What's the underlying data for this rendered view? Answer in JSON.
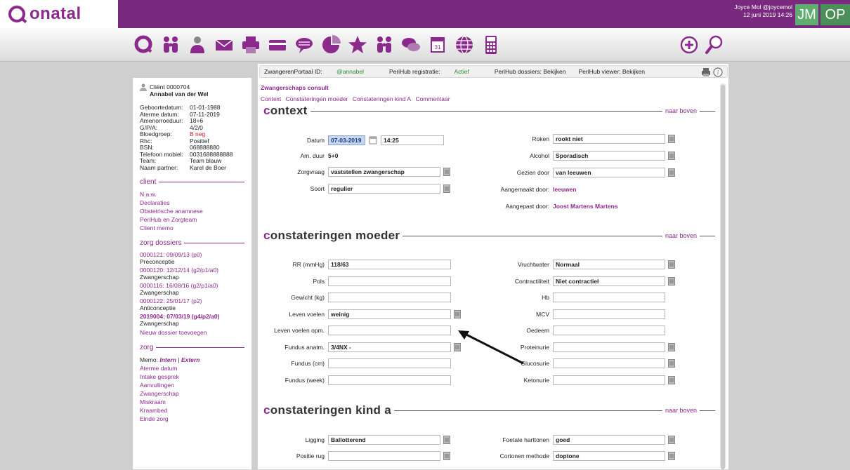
{
  "app": {
    "logo": "onatal",
    "user_name": "Joyce Mol @joycemol",
    "user_date": "12 juni 2019 14:26",
    "badge_jm": "JM",
    "badge_op": "OP"
  },
  "sidebar": {
    "client_id": "Cliënt 0000704",
    "client_name": "Annabel van der Wel",
    "details": [
      {
        "k": "Geboortedatum:",
        "v": "01-01-1988"
      },
      {
        "k": "Aterme datum:",
        "v": "07-11-2019"
      },
      {
        "k": "Amenorroeduur:",
        "v": "18+6"
      },
      {
        "k": "G/P/A:",
        "v": "4/2/0"
      },
      {
        "k": "Bloedgroep:",
        "v": "B neg"
      },
      {
        "k": "Rhc:",
        "v": "Positief"
      },
      {
        "k": "BSN:",
        "v": "068888880"
      },
      {
        "k": "Telefoon mobiel:",
        "v": "0031688888888"
      },
      {
        "k": "Team:",
        "v": "Team blauw"
      },
      {
        "k": "Naam partner:",
        "v": "Karel de Boer"
      }
    ],
    "client_section": "client",
    "client_links": [
      "N.a.w.",
      "Declaraties",
      "Obstetrische anamnese",
      "PeriHub en Zorgteam",
      "Client memo"
    ],
    "dossiers_section": "zorg dossiers",
    "dossiers": [
      {
        "link": "0000121: 09/09/13 (p0)",
        "sub": "Preconceptie"
      },
      {
        "link": "0000120: 12/12/14 (g2/p1/a0)",
        "sub": "Zwangerschap"
      },
      {
        "link": "0000116: 16/08/16 (g2/p1/a0)",
        "sub": "Zwangerschap"
      },
      {
        "link": "0000122: 25/01/17 (p2)",
        "sub": "Anticonceptie"
      },
      {
        "link": "2019004: 07/03/19 (g4/p2/a0)",
        "sub": "Zwangerschap"
      }
    ],
    "new_dossier": "Nieuw dossier toevoegen",
    "zorg_section": "zorg",
    "memo_label": "Memo:",
    "memo_intern": "Intern",
    "memo_sep": "|",
    "memo_extern": "Extern",
    "zorg_links": [
      "Aterme datum",
      "Intake gesprek",
      "Aanvullingen",
      "Zwangerschap",
      "Miskraam",
      "Kraambed",
      "Einde zorg"
    ]
  },
  "portal": {
    "id_label": "ZwangerenPortaal ID:",
    "id_value": "@annabel",
    "reg_label": "PeriHub registratie:",
    "reg_value": "Actief",
    "dossiers": "PeriHub dossiers: Bekijken",
    "viewer": "PeriHub viewer: Bekijken"
  },
  "consult": {
    "title": "Zwangerschaps consult",
    "tabs": [
      "Context",
      "Constateringen moeder",
      "Constateringen kind A",
      "Commentaar"
    ],
    "naar_boven": "naar boven"
  },
  "context": {
    "heading_first": "c",
    "heading_rest": "ontext",
    "datum_label": "Datum",
    "datum_value": "07-03-2019",
    "tijd_value": "14:25",
    "amduur_label": "Am. duur",
    "amduur_value": "5+0",
    "zorgvraag_label": "Zorgvraag",
    "zorgvraag_value": "vaststellen zwangerschap",
    "soort_label": "Soort",
    "soort_value": "regulier",
    "roken_label": "Roken",
    "roken_value": "rookt niet",
    "alcohol_label": "Alcohol",
    "alcohol_value": "Sporadisch",
    "gezien_label": "Gezien door",
    "gezien_value": "van leeuwen",
    "aangemaakt_label": "Aangemaakt door:",
    "aangemaakt_value": "leeuwen",
    "aangepast_label": "Aangepast door:",
    "aangepast_value": "Joost Martens Martens"
  },
  "moeder": {
    "heading_first": "c",
    "heading_rest": "onstateringen moeder",
    "left": [
      {
        "label": "RR (mmHg)",
        "value": "118/63",
        "doc": false
      },
      {
        "label": "Pols",
        "value": "",
        "doc": false
      },
      {
        "label": "Gewicht (kg)",
        "value": "",
        "doc": false
      },
      {
        "label": "Leven voelen",
        "value": "weinig",
        "doc": true
      },
      {
        "label": "Leven voelen opm.",
        "value": "",
        "doc": false
      },
      {
        "label": "Fundus anatm.",
        "value": "3/4NX -",
        "doc": true
      },
      {
        "label": "Fundus (cm)",
        "value": "",
        "doc": false
      },
      {
        "label": "Fundus (week)",
        "value": "",
        "doc": false
      }
    ],
    "right": [
      {
        "label": "Vruchtwater",
        "value": "Normaal",
        "doc": true
      },
      {
        "label": "Contractiliteit",
        "value": "Niet contractiel",
        "doc": true
      },
      {
        "label": "Hb",
        "value": "",
        "doc": false
      },
      {
        "label": "MCV",
        "value": "",
        "doc": false
      },
      {
        "label": "Oedeem",
        "value": "",
        "doc": false
      },
      {
        "label": "Proteinurie",
        "value": "",
        "doc": true
      },
      {
        "label": "Glucosurie",
        "value": "",
        "doc": true
      },
      {
        "label": "Ketonurie",
        "value": "",
        "doc": true
      }
    ]
  },
  "kind": {
    "heading_first": "c",
    "heading_rest": "onstateringen kind a",
    "ligging_label": "Ligging",
    "ligging_value": "Ballotterend",
    "positie_label": "Positie rug",
    "positie_value": "",
    "harttonen_label": "Foetale harttonen",
    "harttonen_value": "goed",
    "cortonen_label": "Cortonen methode",
    "cortonen_value": "doptone"
  }
}
